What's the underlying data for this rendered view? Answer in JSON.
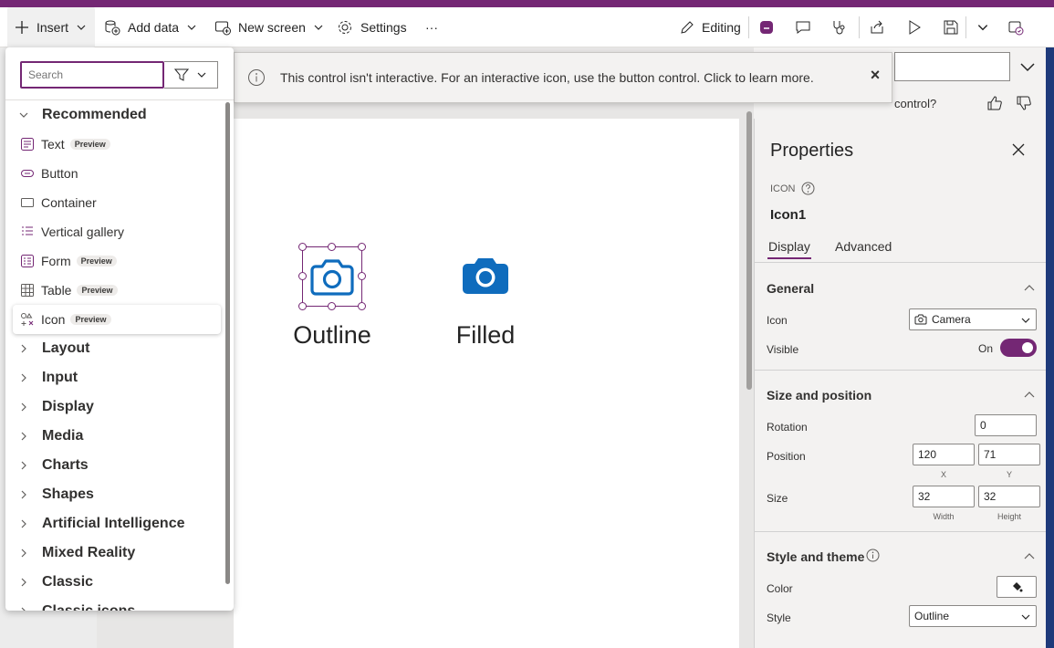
{
  "toolbar": {
    "insert": "Insert",
    "add_data": "Add data",
    "new_screen": "New screen",
    "settings": "Settings",
    "more": "···",
    "editing": "Editing"
  },
  "insert_panel": {
    "search_placeholder": "Search",
    "recommended_label": "Recommended",
    "items": [
      {
        "label": "Text",
        "badge": "Preview",
        "icon": "text-icon"
      },
      {
        "label": "Button",
        "badge": "",
        "icon": "button-icon"
      },
      {
        "label": "Container",
        "badge": "",
        "icon": "container-icon"
      },
      {
        "label": "Vertical gallery",
        "badge": "",
        "icon": "gallery-icon"
      },
      {
        "label": "Form",
        "badge": "Preview",
        "icon": "form-icon"
      },
      {
        "label": "Table",
        "badge": "Preview",
        "icon": "table-icon"
      },
      {
        "label": "Icon",
        "badge": "Preview",
        "icon": "icon-control-icon"
      }
    ],
    "categories": [
      "Layout",
      "Input",
      "Display",
      "Media",
      "Charts",
      "Shapes",
      "Artificial Intelligence",
      "Mixed Reality",
      "Classic",
      "Classic icons"
    ]
  },
  "banner": {
    "message": "This control isn't interactive. For an interactive icon, use the button control. Click to learn more.",
    "close": "×"
  },
  "feedback": {
    "text": "control?"
  },
  "canvas": {
    "outline_label": "Outline",
    "filled_label": "Filled",
    "icon_color": "#0f6cbd"
  },
  "properties": {
    "title": "Properties",
    "type_label": "ICON",
    "control_name": "Icon1",
    "tabs": [
      "Display",
      "Advanced"
    ],
    "general": {
      "title": "General",
      "icon_label": "Icon",
      "icon_value": "Camera",
      "visible_label": "Visible",
      "visible_value": "On"
    },
    "size_position": {
      "title": "Size and position",
      "rotation_label": "Rotation",
      "rotation_value": "0",
      "position_label": "Position",
      "x_value": "120",
      "y_value": "71",
      "x_label": "X",
      "y_label": "Y",
      "size_label": "Size",
      "width_value": "32",
      "height_value": "32",
      "width_label": "Width",
      "height_label": "Height"
    },
    "style_theme": {
      "title": "Style and theme",
      "color_label": "Color",
      "style_label": "Style",
      "style_value": "Outline"
    }
  },
  "colors": {
    "accent": "#742774",
    "icon_blue": "#0f6cbd"
  }
}
